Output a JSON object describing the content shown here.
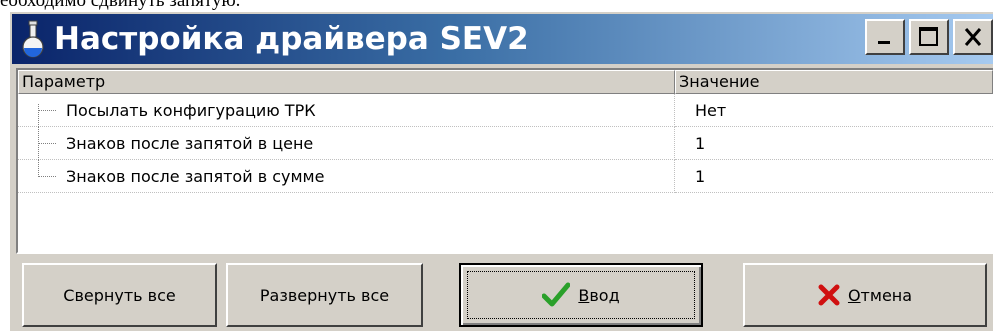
{
  "top_text": "еобходимо сдвинуть запятую.",
  "window": {
    "title": "Настройка драйвера SEV2",
    "title_icon": "flask-icon",
    "controls": {
      "minimize_icon": "minimize-icon",
      "maximize_icon": "maximize-icon",
      "close_icon": "close-icon"
    }
  },
  "grid": {
    "columns": {
      "param": "Параметр",
      "value": "Значение"
    },
    "rows": [
      {
        "param": "Посылать конфигурацию ТРК",
        "value": "Нет"
      },
      {
        "param": "Знаков после запятой в цене",
        "value": "1"
      },
      {
        "param": "Знаков после запятой в сумме",
        "value": "1"
      }
    ]
  },
  "buttons": {
    "collapse_all": "Свернуть все",
    "expand_all": "Развернуть все",
    "ok": {
      "first": "В",
      "rest": "вод",
      "icon": "checkmark-icon",
      "color": "#2aa02a"
    },
    "cancel": {
      "first": "О",
      "rest": "тмена",
      "icon": "cross-icon",
      "color": "#d01010"
    }
  }
}
